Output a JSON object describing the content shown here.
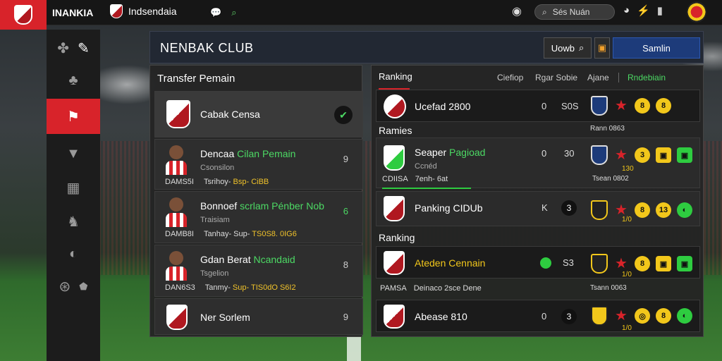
{
  "topbar": {
    "title": "INANKIA",
    "club_name": "Indsendaia",
    "search_text": "Sés Nuán"
  },
  "header": {
    "club_title": "NENBAK CLUB",
    "btn1_label": "Uowb",
    "btn3_label": "Samlin"
  },
  "transfer": {
    "title": "Transfer Pemain",
    "rows": [
      {
        "name": "Cabak Censa",
        "name_green": "",
        "sub": "",
        "meta": "",
        "meta_hl": "",
        "num": ""
      },
      {
        "name": "Dencaa ",
        "name_green": "Cilan Pemain",
        "sub": "Csonsilon",
        "meta": "Tsrihoy- ",
        "meta_hl": "Bsp- CiBB",
        "num": "9"
      },
      {
        "name": "Bonnoef ",
        "name_green": "scrlam Pénber Nob",
        "sub": "Traisiam",
        "meta": "Tanhay- Sup- ",
        "meta_hl": "TS0S8. 0IG6",
        "num": "6"
      },
      {
        "name": "Gdan Berat ",
        "name_green": "Ncandaid",
        "sub": "Tsgelion",
        "meta": "Tanmy- ",
        "meta_hl": "Sup- TIS0dO S6I2",
        "num": "8"
      },
      {
        "name": "Ner Sorlem",
        "name_green": "",
        "sub": "",
        "meta": "",
        "meta_hl": "",
        "num": "9"
      }
    ],
    "row_labels": [
      "DAMS5I",
      "DAMB8I",
      "DAN6S3"
    ]
  },
  "ranking": {
    "tab_main": "Ranking",
    "tabs": [
      "Ciefiop",
      "Rgar Sobie",
      "Ajane",
      "Rndebiain"
    ],
    "rows": [
      {
        "name": "Ucefad 2800",
        "v1": "0",
        "v2": "S0S",
        "badge_sub": "Rann   0863"
      },
      {
        "name": "Seaper ",
        "name_green": "Pagioad",
        "sub": "Ccnéd",
        "v1": "0",
        "v2": "30",
        "badge_sub": "Tsean   0802"
      },
      {
        "name": "Panking CIDUb",
        "v1": "K",
        "v2": "3",
        "badge_sub": ""
      },
      {
        "name": "Ateden Cennain",
        "v1": "",
        "v2": "S3",
        "badge_sub": "Tsann   0063"
      },
      {
        "name": "Abease 810",
        "v1": "0",
        "v2": "3",
        "badge_sub": ""
      }
    ],
    "section1": "Ramies",
    "row_label1": "CDIISA",
    "row_label1_b": "7enh- 6at",
    "section2": "Ranking",
    "row_label2": "PAMSA",
    "row_label2_b": "Deinaco 2sce Dene",
    "badge_nums": [
      "130",
      "1/0",
      "1/0",
      "1/0"
    ],
    "badge_circ": [
      "8",
      "3",
      "8",
      "8"
    ],
    "badge_circ2": [
      "8",
      "3",
      "13",
      "8"
    ]
  },
  "sidebar": {
    "items": [
      "puzzle-icon",
      "clover-icon",
      "flag-icon",
      "shirt-icon",
      "grid-icon",
      "person-icon",
      "chart-icon",
      "pitch-icon"
    ]
  },
  "colors": {
    "accent": "#d8232a",
    "green": "#4cd964",
    "gold": "#f2c71b"
  }
}
